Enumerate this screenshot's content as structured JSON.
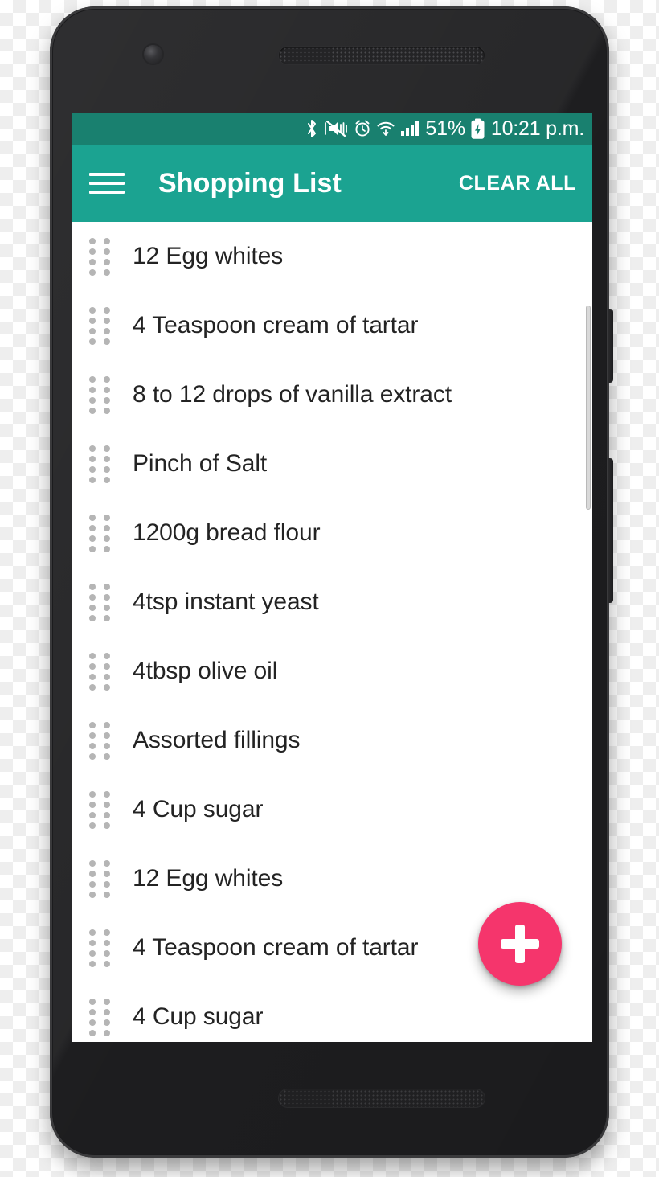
{
  "device": {
    "hardware": {
      "front_camera": "front-camera",
      "earpiece": "earpiece-speaker",
      "bottom_speaker": "bottom-speaker",
      "power_button": "power-button",
      "volume_rocker": "volume-rocker"
    }
  },
  "colors": {
    "status_bar": "#19806f",
    "app_bar": "#1ba391",
    "fab": "#f5356c",
    "screen_bg": "#ffffff",
    "handle_dot": "#b5b5b5",
    "item_text": "#232323"
  },
  "status_bar": {
    "icons": [
      "bluetooth-icon",
      "vibrate-mute-icon",
      "alarm-icon",
      "wifi-icon",
      "signal-icon",
      "battery-charging-icon"
    ],
    "battery_percent": "51%",
    "clock": "10:21 p.m."
  },
  "app_bar": {
    "menu_icon": "hamburger-menu-icon",
    "title": "Shopping List",
    "clear_all_label": "CLEAR ALL"
  },
  "list": {
    "drag_handle_icon": "drag-handle-icon",
    "items": [
      {
        "label": "12 Egg whites"
      },
      {
        "label": "4 Teaspoon cream of tartar"
      },
      {
        "label": "8 to 12 drops of vanilla extract"
      },
      {
        "label": "Pinch of Salt"
      },
      {
        "label": "1200g bread flour"
      },
      {
        "label": "4tsp instant yeast"
      },
      {
        "label": "4tbsp olive oil"
      },
      {
        "label": "Assorted fillings"
      },
      {
        "label": "4 Cup sugar"
      },
      {
        "label": "12 Egg whites"
      },
      {
        "label": "4 Teaspoon cream of tartar"
      },
      {
        "label": "4 Cup sugar"
      }
    ]
  },
  "fab": {
    "icon": "plus-icon",
    "label": "+"
  }
}
